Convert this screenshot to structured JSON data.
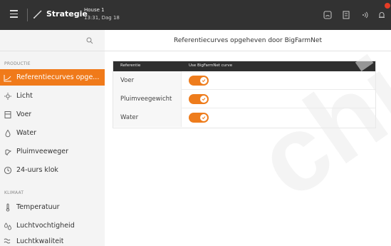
{
  "topbar": {
    "module_title": "Strategie",
    "house": "House 1",
    "day_time": "13:31, Dag 18",
    "notification_count": "",
    "icons": [
      "menu-icon",
      "strategy-icon",
      "dashboard-icon",
      "document-icon",
      "broadcast-icon",
      "bell-icon"
    ],
    "accent_color": "#e53c25"
  },
  "sidebar": {
    "search_placeholder": "",
    "sections": [
      {
        "label": "PRODUCTIE",
        "items": [
          {
            "label": "Referentiecurves opge...",
            "icon": "curve-icon",
            "active": true
          },
          {
            "label": "Licht",
            "icon": "light-icon"
          },
          {
            "label": "Voer",
            "icon": "feed-icon"
          },
          {
            "label": "Water",
            "icon": "water-icon"
          },
          {
            "label": "Pluimveeweger",
            "icon": "poultry-icon"
          },
          {
            "label": "24-uurs klok",
            "icon": "clock-icon"
          }
        ]
      },
      {
        "label": "KLIMAAT",
        "items": [
          {
            "label": "Temperatuur",
            "icon": "thermometer-icon"
          },
          {
            "label": "Luchtvochtigheid",
            "icon": "humidity-icon"
          },
          {
            "label": "Luchtkwaliteit",
            "icon": "air-quality-icon"
          }
        ]
      }
    ],
    "active_color": "#f07a1a"
  },
  "main": {
    "title": "Referentiecurves opgeheven door BigFarmNet",
    "table": {
      "headers": [
        "Referentie",
        "Use BigFarmNet curve"
      ],
      "rows": [
        {
          "reference": "Voer",
          "use_bigfarmnet": true
        },
        {
          "reference": "Pluimveegewicht",
          "use_bigfarmnet": true
        },
        {
          "reference": "Water",
          "use_bigfarmnet": true
        }
      ]
    },
    "toggle_color": "#ee7c1c"
  },
  "watermark": {
    "text": "chin"
  }
}
